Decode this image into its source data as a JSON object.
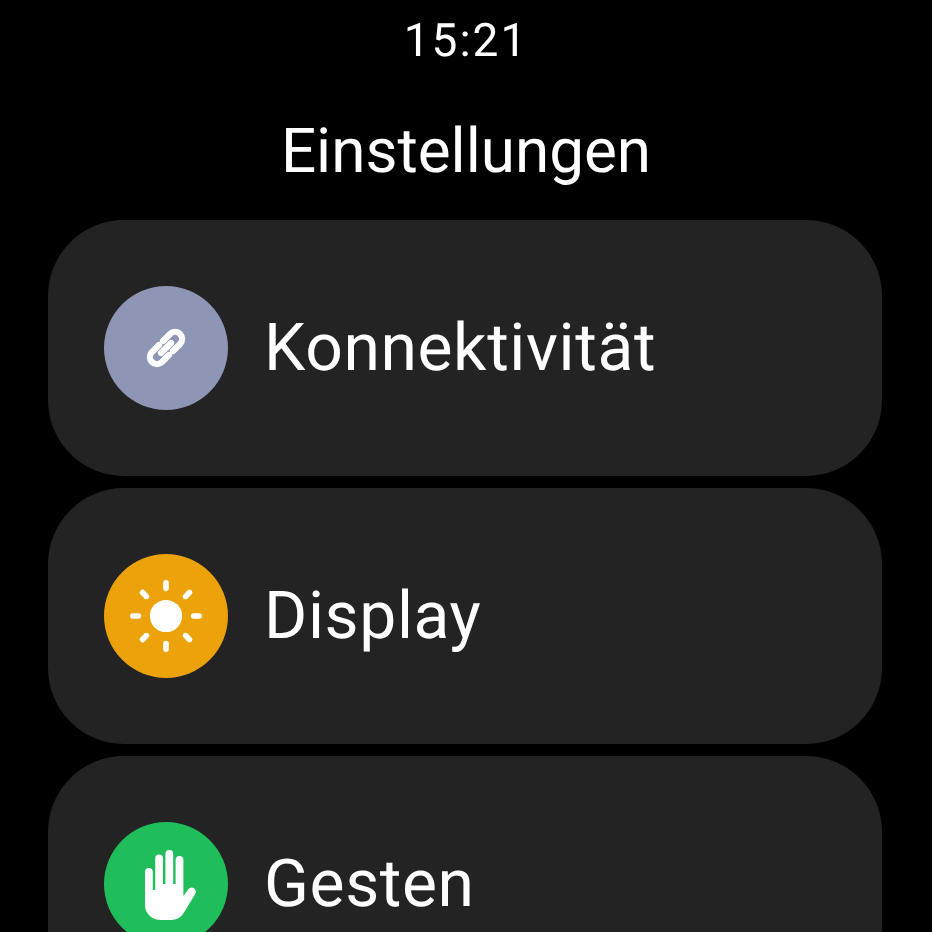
{
  "status_bar": {
    "time": "15:21"
  },
  "title": "Einstellungen",
  "items": [
    {
      "label": "Konnektivität",
      "kind": "link",
      "color": "#8e95b5"
    },
    {
      "label": "Display",
      "kind": "sun",
      "color": "#eca20a"
    },
    {
      "label": "Gesten",
      "kind": "hand",
      "color": "#1fbe5a"
    }
  ]
}
